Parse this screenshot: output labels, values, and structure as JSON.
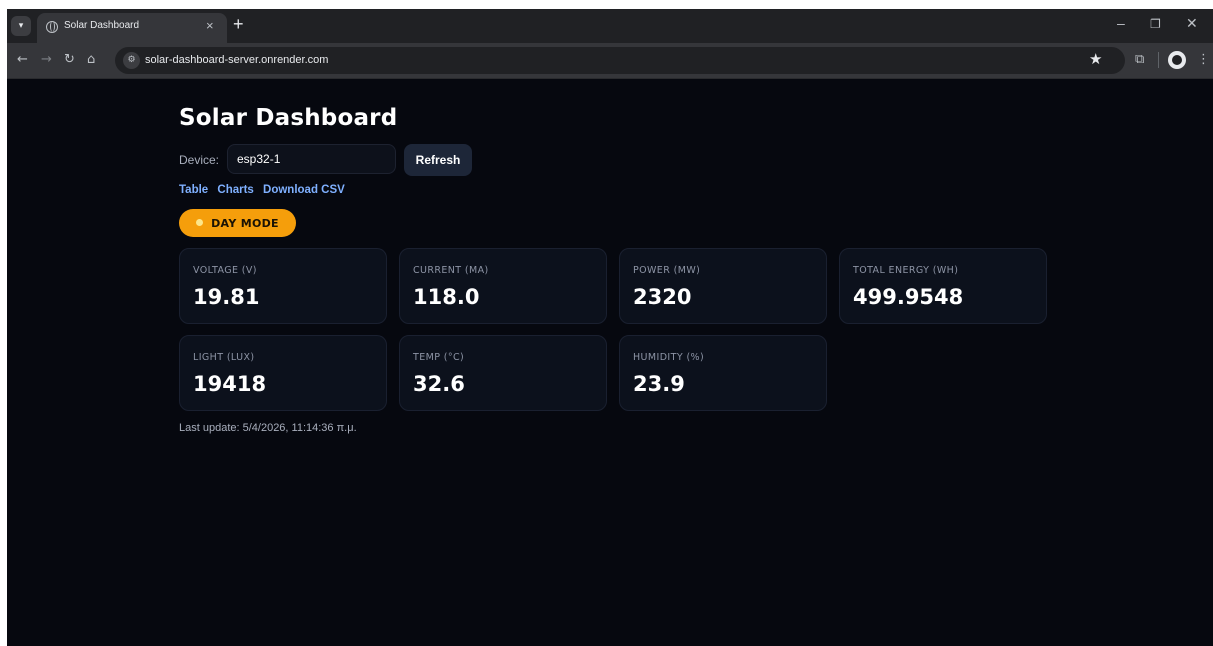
{
  "browser": {
    "tab_title": "Solar Dashboard",
    "tab_close": "×",
    "new_tab": "+",
    "url": "solar-dashboard-server.onrender.com"
  },
  "page": {
    "title": "Solar Dashboard",
    "device_label": "Device:",
    "device_value": "esp32-1",
    "refresh_label": "Refresh",
    "links": [
      "Table",
      "Charts",
      "Download CSV"
    ],
    "mode_label": "DAY MODE",
    "cards": [
      {
        "label": "VOLTAGE (V)",
        "value": "19.81"
      },
      {
        "label": "CURRENT (MA)",
        "value": "118.0"
      },
      {
        "label": "POWER (MW)",
        "value": "2320"
      },
      {
        "label": "TOTAL ENERGY (WH)",
        "value": "499.9548"
      },
      {
        "label": "LIGHT (LUX)",
        "value": "19418"
      },
      {
        "label": "TEMP (°C)",
        "value": "32.6"
      },
      {
        "label": "HUMIDITY (%)",
        "value": "23.9"
      }
    ],
    "last_update": "Last update: 5/4/2026, 11:14:36 π.μ."
  },
  "colors": {
    "background": "#06080f",
    "card": "#0c111c",
    "accent_orange": "#f59e0b",
    "link_blue": "#7fb0ff"
  },
  "icons": [
    "tab-search-icon",
    "globe-icon",
    "back-icon",
    "forward-icon",
    "reload-icon",
    "home-icon",
    "site-info-icon",
    "star-icon",
    "extensions-icon",
    "profile-icon",
    "menu-icon",
    "minimize-icon",
    "maximize-icon",
    "close-icon",
    "sun-icon"
  ]
}
